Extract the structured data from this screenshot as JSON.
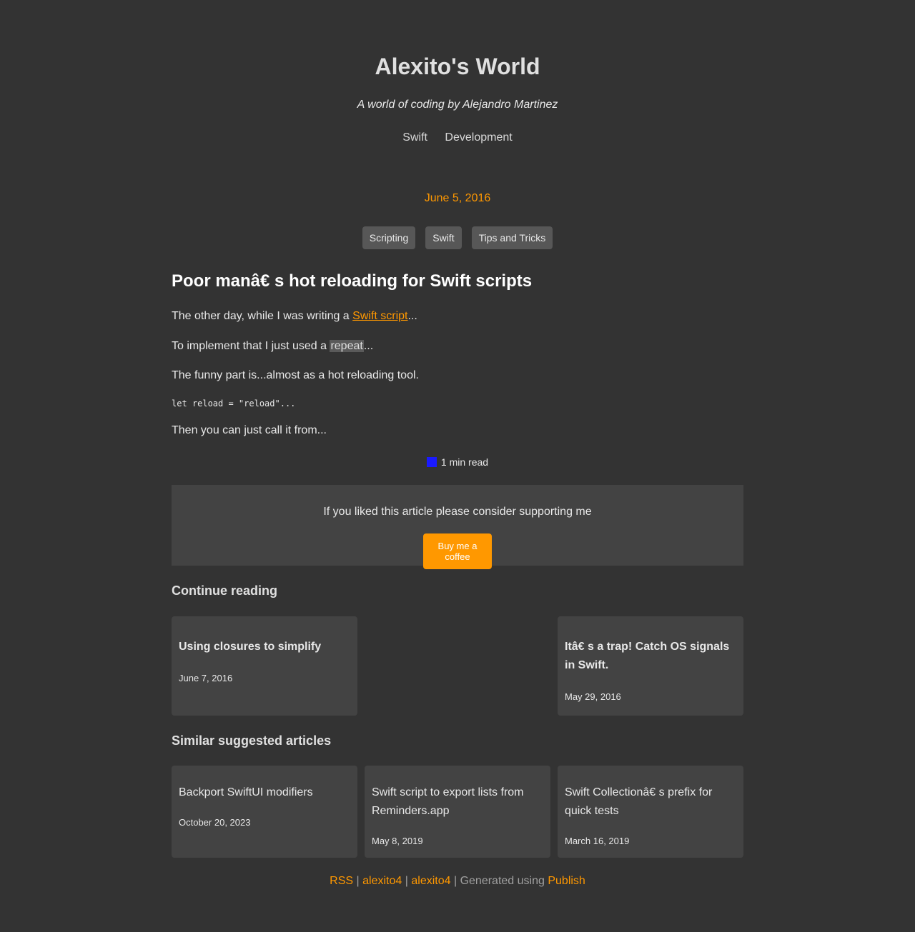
{
  "site": {
    "title": "Alexito's World",
    "description": "A world of coding by Alejandro Martinez",
    "nav": [
      "Swift",
      "Development"
    ]
  },
  "post": {
    "date": "June 5, 2016",
    "tags": [
      "Scripting",
      "Swift",
      "Tips and Tricks"
    ],
    "title": "Poor manâ€   s hot reloading for Swift scripts",
    "p1": {
      "before": "The other day, while I was writing a ",
      "link": "Swift script",
      "after": "..."
    },
    "p2": {
      "before": "To implement that I just used a ",
      "code": "repeat",
      "after": "..."
    },
    "p3": "The funny part is...almost as a hot reloading tool.",
    "code": "let reload = \"reload\"...",
    "p5": "Then you can just call it from...",
    "read_time": "1 min read",
    "read_time_icon": "clock-icon"
  },
  "support": {
    "text": "If you liked this article please consider supporting me",
    "button": "Buy me a coffee"
  },
  "continue_reading": {
    "heading": "Continue reading",
    "previous": {
      "title": "Using closures to simplify",
      "date": "June 7, 2016"
    },
    "next": {
      "title": "Itâ€   s a trap! Catch OS signals in Swift.",
      "date": "May 29, 2016"
    }
  },
  "similar": {
    "heading": "Similar suggested articles",
    "items": [
      {
        "title": "Backport SwiftUI modifiers",
        "date": "October 20, 2023"
      },
      {
        "title": "Swift script to export lists from Reminders.app",
        "date": "May 8, 2019"
      },
      {
        "title": "Swift Collectionâ€   s prefix for quick tests",
        "date": "March 16, 2019"
      }
    ]
  },
  "footer": {
    "rss": "RSS",
    "sep": "|",
    "link2": "alexito4",
    "link3": "alexito4",
    "generated": "Generated using",
    "publish": "Publish"
  },
  "colors": {
    "background": "#333333",
    "accent": "#ff9800",
    "card": "#434343",
    "tag": "#575757"
  }
}
